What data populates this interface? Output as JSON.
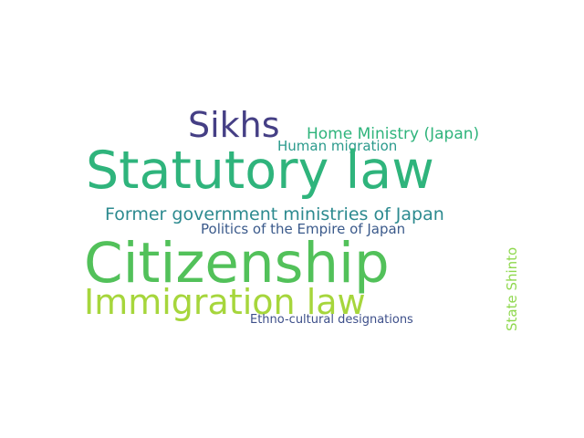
{
  "words": [
    {
      "text": "Sikhs",
      "color": "#453f85"
    },
    {
      "text": "Home Ministry (Japan)",
      "color": "#2fb47c"
    },
    {
      "text": "Human migration",
      "color": "#2a9a8c"
    },
    {
      "text": "Statutory law",
      "color": "#2fb47c"
    },
    {
      "text": "Former government ministries of Japan",
      "color": "#2c8a8f"
    },
    {
      "text": "Politics of the Empire of Japan",
      "color": "#3b5a8b"
    },
    {
      "text": "Citizenship",
      "color": "#52c15a"
    },
    {
      "text": "Immigration law",
      "color": "#a6d63c"
    },
    {
      "text": "Ethno-cultural designations",
      "color": "#3d4f8a"
    },
    {
      "text": "State Shinto",
      "color": "#8fd84e"
    }
  ]
}
